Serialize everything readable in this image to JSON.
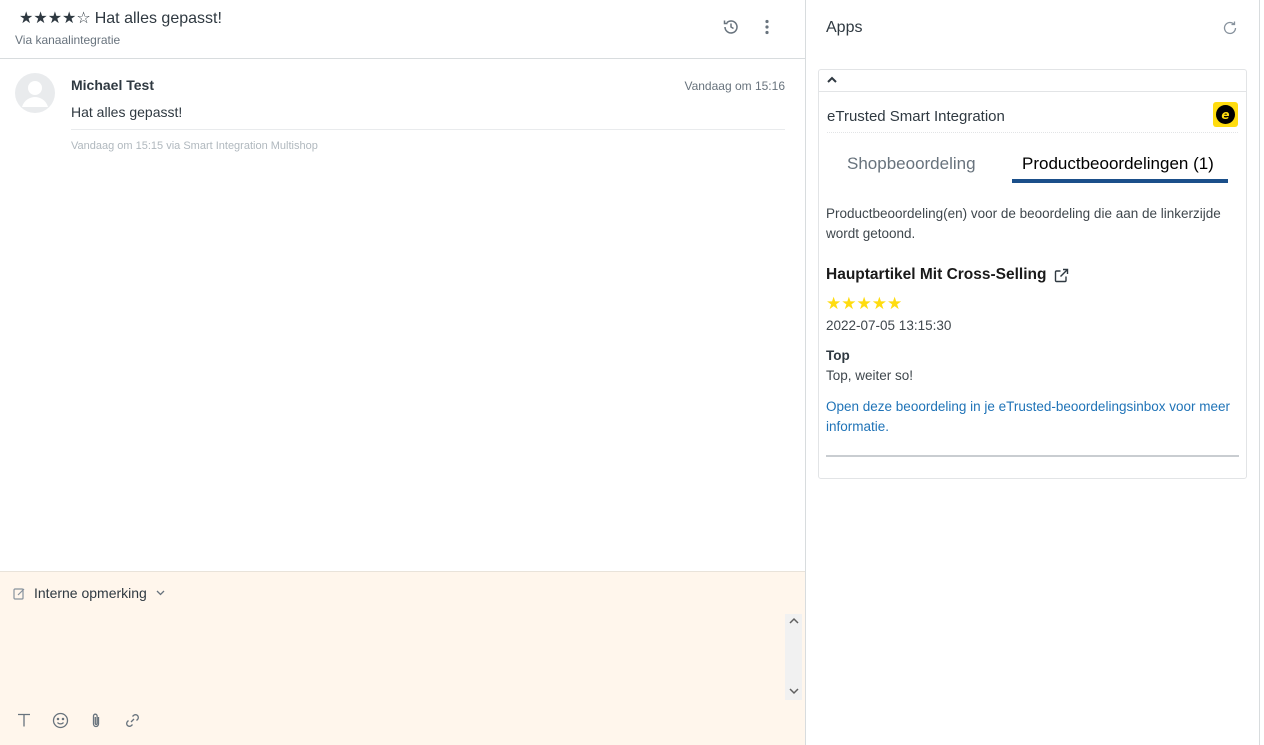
{
  "ticket": {
    "stars": "★★★★☆",
    "title": "Hat alles gepasst!",
    "via": "Via kanaalintegratie"
  },
  "message": {
    "author": "Michael Test",
    "time": "Vandaag om 15:16",
    "body": "Hat alles gepasst!",
    "meta": "Vandaag om 15:15 via Smart Integration Multishop"
  },
  "composer": {
    "mode_label": "Interne opmerking"
  },
  "apps_panel": {
    "title": "Apps",
    "app": {
      "name": "eTrusted Smart Integration",
      "tabs": [
        {
          "label": "Shopbeoordeling",
          "active": false
        },
        {
          "label": "Productbeoordelingen (1)",
          "active": true
        }
      ],
      "description": "Productbeoordeling(en) voor de beoordeling die aan de linkerzijde wordt getoond.",
      "review": {
        "product_title": "Hauptartikel Mit Cross-Selling",
        "stars": "★★★★★",
        "rating": 5,
        "date": "2022-07-05 13:15:30",
        "headline": "Top",
        "text": "Top, weiter so!",
        "link_text": "Open deze beoordeling in je eTrusted-beoordelingsinbox voor meer informatie."
      }
    }
  },
  "colors": {
    "accent_tab": "#1b4f8a",
    "link": "#1f73b7",
    "star": "#ffdc0f",
    "composer_bg": "#fff6ec"
  },
  "icons": [
    "history-icon",
    "more-vertical-icon",
    "refresh-icon",
    "chevron-up-icon",
    "external-link-icon",
    "text-format-icon",
    "emoji-icon",
    "attachment-icon",
    "link-icon",
    "internal-note-icon",
    "chevron-down-icon"
  ]
}
